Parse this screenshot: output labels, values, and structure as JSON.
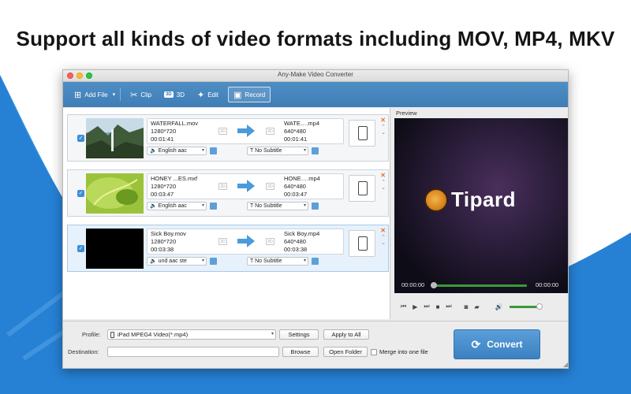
{
  "headline": "Support all kinds of video formats including MOV, MP4, MKV",
  "window": {
    "title": "Any-Make Video Converter"
  },
  "toolbar": {
    "add_file": "Add File",
    "clip": "Clip",
    "threed_badge": "3D",
    "threed": "3D",
    "edit": "Edit",
    "record": "Record"
  },
  "files": [
    {
      "src_name": "WATERFALL.mov",
      "src_res": "1280*720",
      "src_dur": "00:01:41",
      "dst_name": "WATE….mp4",
      "dst_res": "640*480",
      "dst_dur": "00:01:41",
      "audio": "English aac",
      "subtitle": "No Subtitle",
      "twod": "2D"
    },
    {
      "src_name": "HONEY ...ES.mxf",
      "src_res": "1280*720",
      "src_dur": "00:03:47",
      "dst_name": "HONE….mp4",
      "dst_res": "640*480",
      "dst_dur": "00:03:47",
      "audio": "English aac",
      "subtitle": "No Subtitle",
      "twod": "2D"
    },
    {
      "src_name": "Sick Boy.mov",
      "src_res": "1280*720",
      "src_dur": "00:03:38",
      "dst_name": "Sick Boy.mp4",
      "dst_res": "640*480",
      "dst_dur": "00:03:38",
      "audio": "und aac ste",
      "subtitle": "No Subtitle",
      "twod": "2D"
    }
  ],
  "preview": {
    "label": "Preview",
    "logo_text": "Tipard",
    "time_current": "00:00:00",
    "time_total": "00:00:00"
  },
  "bottom": {
    "profile_label": "Profile:",
    "profile_value": "iPad MPEG4 Video(*.mp4)",
    "settings": "Settings",
    "apply_all": "Apply to All",
    "destination_label": "Destination:",
    "destination_value": "",
    "browse": "Browse",
    "open_folder": "Open Folder",
    "merge": "Merge into one file",
    "convert": "Convert"
  },
  "colors": {
    "accent": "#3f7db6",
    "background_wave": "#2f8fe0"
  }
}
